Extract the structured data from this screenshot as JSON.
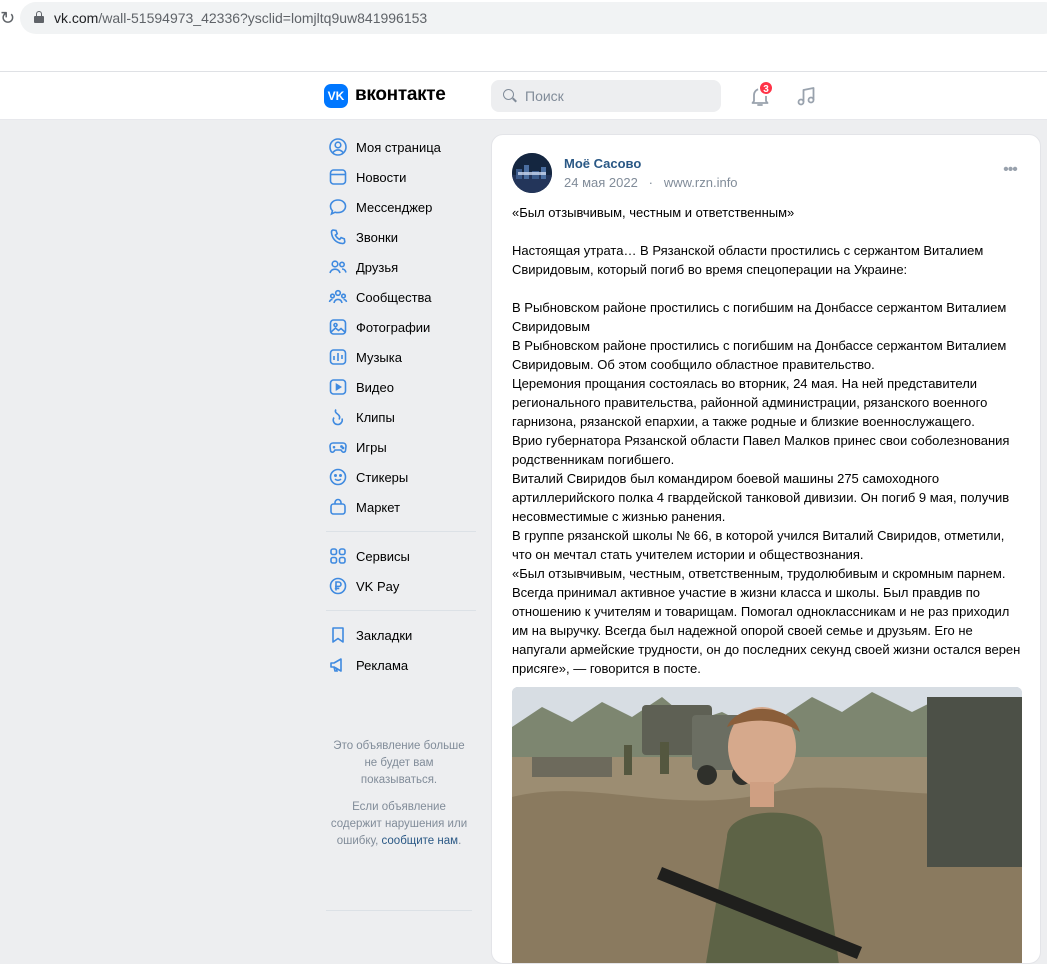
{
  "browser": {
    "url_host": "vk.com",
    "url_path": "/wall-51594973_42336?ysclid=lomjltq9uw841996153"
  },
  "header": {
    "logo_text": "VK",
    "wordmark": "вконтакте",
    "search_placeholder": "Поиск",
    "notifications_count": "3"
  },
  "menu": {
    "items": [
      {
        "label": "Моя страница",
        "icon": "profile-icon"
      },
      {
        "label": "Новости",
        "icon": "news-icon"
      },
      {
        "label": "Мессенджер",
        "icon": "messenger-icon"
      },
      {
        "label": "Звонки",
        "icon": "phone-icon"
      },
      {
        "label": "Друзья",
        "icon": "friends-icon"
      },
      {
        "label": "Сообщества",
        "icon": "communities-icon"
      },
      {
        "label": "Фотографии",
        "icon": "photos-icon"
      },
      {
        "label": "Музыка",
        "icon": "music-icon"
      },
      {
        "label": "Видео",
        "icon": "video-icon"
      },
      {
        "label": "Клипы",
        "icon": "clips-icon"
      },
      {
        "label": "Игры",
        "icon": "games-icon"
      },
      {
        "label": "Стикеры",
        "icon": "stickers-icon"
      },
      {
        "label": "Маркет",
        "icon": "market-icon"
      }
    ],
    "services": [
      {
        "label": "Сервисы",
        "icon": "services-icon"
      },
      {
        "label": "VK Pay",
        "icon": "vkpay-icon"
      }
    ],
    "extras": [
      {
        "label": "Закладки",
        "icon": "bookmarks-icon"
      },
      {
        "label": "Реклама",
        "icon": "ads-icon"
      }
    ]
  },
  "ad_note": {
    "line1": "Это объявление больше не будет вам показываться.",
    "line2_prefix": "Если объявление содержит нарушения или ошибку,",
    "line2_link": "сообщите нам",
    "line2_suffix": "."
  },
  "post": {
    "author": "Моё Сасово",
    "date": "24 мая 2022",
    "source": "www.rzn.info",
    "text": "«Был отзывчивым, честным и ответственным»\n\nНастоящая утрата… В Рязанской области простились с сержантом Виталием Свиридовым, который погиб во время спецоперации на Украине:\n\nВ Рыбновском районе простились с погибшим на Донбассе сержантом Виталием Свиридовым\nВ Рыбновском районе простились с погибшим на Донбассе сержантом Виталием Свиридовым. Об этом сообщило областное правительство.\nЦеремония прощания состоялась во вторник, 24 мая. На ней представители регионального правительства, районной администрации, рязанского военного гарнизона, рязанской епархии, а также родные и близкие военнослужащего.\nВрио губернатора Рязанской области Павел Малков принес свои соболезнования родственникам погибшего.\nВиталий Свиридов был командиром боевой машины 275 самоходного артиллерийского полка 4 гвардейской танковой дивизии. Он погиб 9 мая, получив несовместимые с жизнью ранения.\nВ группе рязанской школы № 66, в которой учился Виталий Свиридов, отметили, что он мечтал стать учителем истории и обществознания.\n«Был отзывчивым, честным, ответственным, трудолюбивым и скромным парнем. Всегда принимал активное участие в жизни класса и школы. Был правдив по отношению к учителям и товарищам. Помогал одноклассникам и не раз приходил им на выручку. Всегда был надежной опорой своей семье и друзьям. Его не напугали армейские трудности, он до последних секунд своей жизни остался верен присяге», — говорится в посте."
  },
  "colors": {
    "accent": "#0077ff",
    "link": "#2a5885",
    "muted": "#818c99",
    "badge": "#ff3347"
  }
}
